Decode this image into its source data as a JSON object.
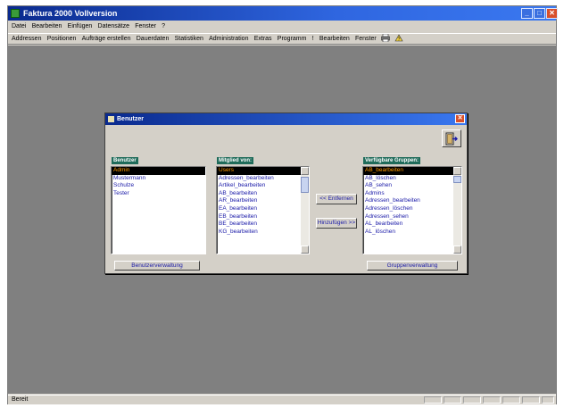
{
  "app": {
    "title": "Faktura 2000 Vollversion",
    "window_controls": {
      "minimize": "_",
      "maximize": "□",
      "close": "✕"
    },
    "menu": [
      "Datei",
      "Bearbeiten",
      "Einfügen",
      "Datensätze",
      "Fenster",
      "?"
    ],
    "toolbar_items": [
      "Addressen",
      "Positionen",
      "Aufträge erstellen",
      "Dauerdaten",
      "Statistiken",
      "Administration",
      "Extras",
      "Programm",
      "!",
      "Bearbeiten",
      "Fenster"
    ],
    "toolbar_icons": [
      "printer-icon",
      "help-icon"
    ],
    "status": "Bereit"
  },
  "dialog": {
    "title": "Benutzer",
    "benutzer_label": "Benutzer",
    "benutzer_items": [
      "Admin",
      "Mustermann",
      "Schulze",
      "Tester"
    ],
    "benutzer_selected": 0,
    "mitglied_label": "Mitglied von:",
    "mitglied_items": [
      "Users",
      "Adressen_bearbeiten",
      "Artikel_bearbeiten",
      "AB_bearbeiten",
      "AR_bearbeiten",
      "EA_bearbeiten",
      "EB_bearbeiten",
      "BE_bearbeiten",
      "KG_bearbeiten"
    ],
    "mitglied_selected": 0,
    "verfuegbar_label": "Verfügbare Gruppen:",
    "verfuegbar_items": [
      "AB_bearbeiten",
      "AB_löschen",
      "AB_sehen",
      "Admins",
      "Adressen_bearbeiten",
      "Adressen_löschen",
      "Adressen_sehen",
      "AL_bearbeiten",
      "AL_löschen"
    ],
    "verfuegbar_selected": 0,
    "btn_entfernen": "<< Entfernen",
    "btn_hinzufuegen": "Hinzufügen >>",
    "btn_benutzerverwaltung": "Benutzerverwaltung",
    "btn_gruppenverwaltung": "Gruppenverwaltung"
  },
  "colors": {
    "titlebar_start": "#0a2a8e",
    "titlebar_end": "#3a78f0",
    "label_bg": "#1f6b5a",
    "list_text": "#1a1aa8",
    "selection_bg": "#000000",
    "selection_text": "#ff9900",
    "workspace": "#808080"
  }
}
